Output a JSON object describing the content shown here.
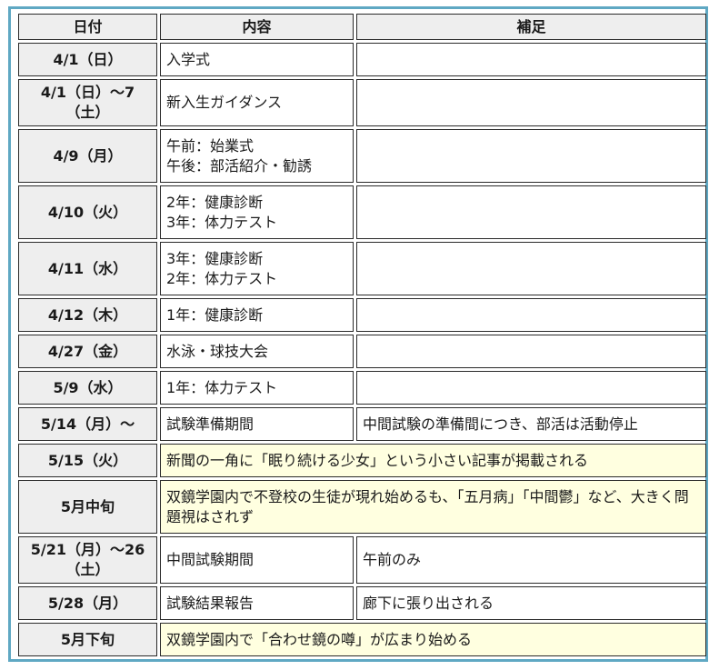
{
  "headers": {
    "date": "日付",
    "content": "内容",
    "note": "補足"
  },
  "rows": [
    {
      "date": "4/1（日）",
      "content": "入学式",
      "note": ""
    },
    {
      "date": "4/1（日）～7（土）",
      "content": "新入生ガイダンス",
      "note": ""
    },
    {
      "date": "4/9（月）",
      "content": "午前：始業式\n午後：部活紹介・勧誘",
      "note": ""
    },
    {
      "date": "4/10（火）",
      "content": "2年：健康診断\n3年：体力テスト",
      "note": ""
    },
    {
      "date": "4/11（水）",
      "content": "3年：健康診断\n2年：体力テスト",
      "note": ""
    },
    {
      "date": "4/12（木）",
      "content": "1年：健康診断",
      "note": ""
    },
    {
      "date": "4/27（金）",
      "content": "水泳・球技大会",
      "note": ""
    },
    {
      "date": "5/9（水）",
      "content": "1年：体力テスト",
      "note": ""
    },
    {
      "date": "5/14（月）～",
      "content": "試験準備期間",
      "note": "中間試験の準備間につき、部活は活動停止"
    },
    {
      "date": "5/15（火）",
      "content": "新聞の一角に「眠り続ける少女」という小さい記事が掲載される",
      "merged": true
    },
    {
      "date": "5月中旬",
      "content": "双鏡学園内で不登校の生徒が現れ始めるも、「五月病」「中間鬱」など、大きく問題視はされず",
      "merged": true
    },
    {
      "date": "5/21（月）～26（土）",
      "content": "中間試験期間",
      "note": "午前のみ"
    },
    {
      "date": "5/28（月）",
      "content": "試験結果報告",
      "note": "廊下に張り出される"
    },
    {
      "date": "5月下旬",
      "content": "双鏡学園内で「合わせ鏡の噂」が広まり始める",
      "merged": true
    }
  ],
  "colors": {
    "frame_border": "#5fa8c3",
    "header_bg": "#eeeeee",
    "highlight_bg": "#ffffe0"
  }
}
